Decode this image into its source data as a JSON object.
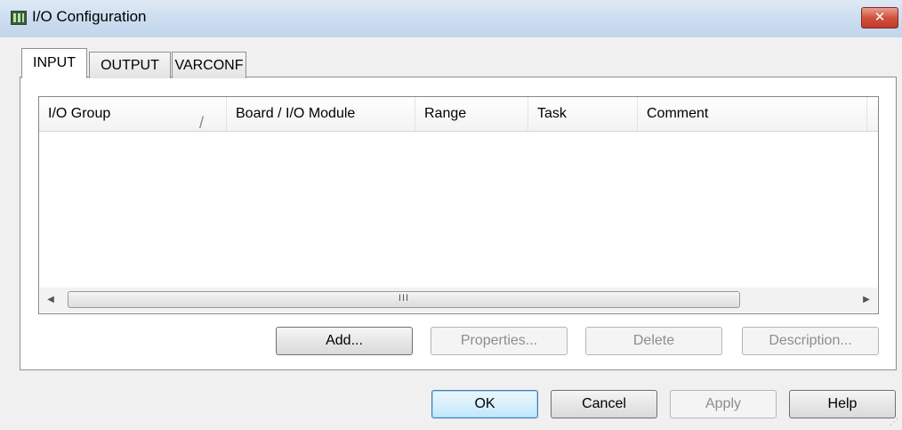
{
  "window": {
    "title": "I/O Configuration",
    "close_glyph": "✕",
    "icon": "io-configuration-icon"
  },
  "tabs": [
    {
      "label": "INPUT",
      "active": true
    },
    {
      "label": "OUTPUT",
      "active": false
    },
    {
      "label": "VARCONF",
      "active": false
    }
  ],
  "table": {
    "columns": [
      "I/O Group",
      "Board / I/O Module",
      "Range",
      "Task",
      "Comment"
    ],
    "sort_glyph": "/",
    "rows": []
  },
  "scrollbar": {
    "left_arrow": "◀",
    "right_arrow": "▶",
    "thumb_grip": "III"
  },
  "panel_buttons": {
    "add": {
      "label": "Add...",
      "enabled": true
    },
    "properties": {
      "label": "Properties...",
      "enabled": false
    },
    "delete": {
      "label": "Delete",
      "enabled": false
    },
    "description": {
      "label": "Description...",
      "enabled": false
    }
  },
  "dialog_buttons": {
    "ok": {
      "label": "OK",
      "enabled": true,
      "default": true
    },
    "cancel": {
      "label": "Cancel",
      "enabled": true
    },
    "apply": {
      "label": "Apply",
      "enabled": false
    },
    "help": {
      "label": "Help",
      "enabled": true
    }
  },
  "colors": {
    "titlebar": "#cbdcef",
    "close": "#c0392b",
    "default_button_border": "#3c7fb1"
  }
}
